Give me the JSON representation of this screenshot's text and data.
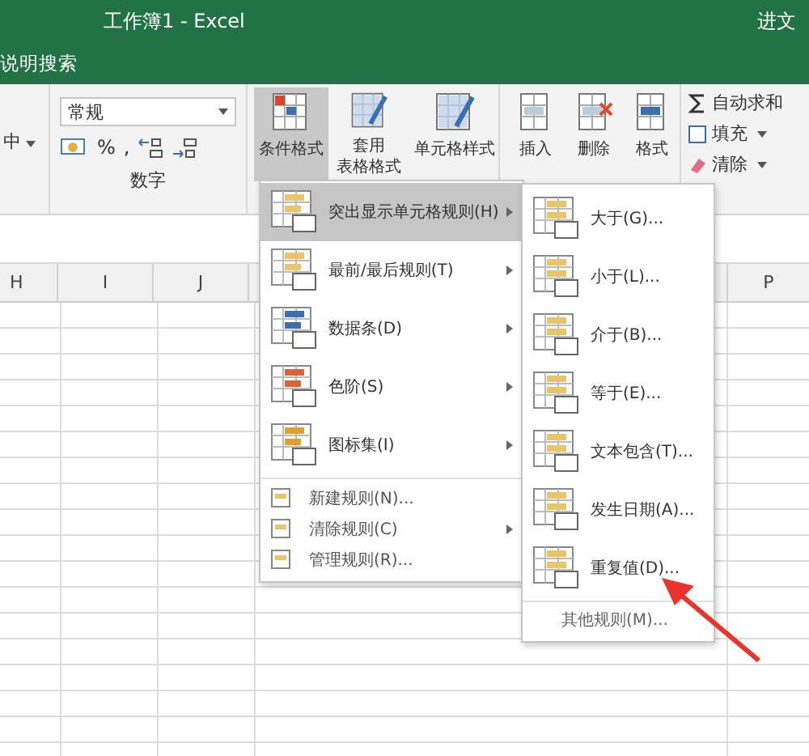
{
  "window": {
    "title": "工作簿1 - Excel",
    "account": "进文"
  },
  "tell_me": "说明搜索",
  "ribbon": {
    "alignment_fragment": "中",
    "number": {
      "format": "常规",
      "percent": "%",
      "comma": ",",
      "label": "数字"
    },
    "styles": [
      {
        "lines": [
          "条件格式"
        ],
        "selected": true
      },
      {
        "lines": [
          "套用",
          "表格格式"
        ],
        "selected": false
      },
      {
        "lines": [
          "单元格样式"
        ],
        "selected": false
      }
    ],
    "cells": [
      {
        "label": "插入"
      },
      {
        "label": "删除"
      },
      {
        "label": "格式"
      }
    ],
    "editing": [
      {
        "label": "自动求和",
        "dropdown": false
      },
      {
        "label": "填充",
        "dropdown": true
      },
      {
        "label": "清除",
        "dropdown": true
      }
    ]
  },
  "columns": [
    "H",
    "I",
    "J",
    "P"
  ],
  "menu": {
    "items": [
      {
        "label": "突出显示单元格规则(H)",
        "kind": "large",
        "submenu": true,
        "selected": true
      },
      {
        "label": "最前/最后规则(T)",
        "kind": "large",
        "submenu": true,
        "selected": false
      },
      {
        "label": "数据条(D)",
        "kind": "large",
        "submenu": true,
        "selected": false
      },
      {
        "label": "色阶(S)",
        "kind": "large",
        "submenu": true,
        "selected": false
      },
      {
        "label": "图标集(I)",
        "kind": "large",
        "submenu": true,
        "selected": false
      },
      {
        "label": "新建规则(N)...",
        "kind": "small",
        "submenu": false,
        "selected": false
      },
      {
        "label": "清除规则(C)",
        "kind": "small",
        "submenu": true,
        "selected": false
      },
      {
        "label": "管理规则(R)...",
        "kind": "small",
        "submenu": false,
        "selected": false
      }
    ]
  },
  "submenu": {
    "items": [
      {
        "label": "大于(G)..."
      },
      {
        "label": "小于(L)..."
      },
      {
        "label": "介于(B)..."
      },
      {
        "label": "等于(E)..."
      },
      {
        "label": "文本包含(T)..."
      },
      {
        "label": "发生日期(A)..."
      },
      {
        "label": "重复值(D)..."
      }
    ],
    "more": "其他规则(M)..."
  }
}
